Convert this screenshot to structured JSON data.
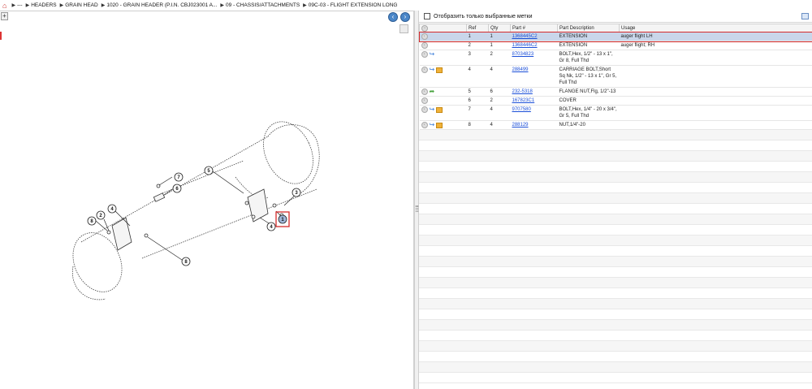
{
  "breadcrumb": {
    "items": [
      "---",
      "HEADERS",
      "GRAIN HEAD",
      "1020 - GRAIN HEADER (P.I.N. CBJ023001 A...",
      "09 - CHASSIS/ATTACHMENTS",
      "09C-03 - FLIGHT EXTENSION LONG"
    ]
  },
  "filter": {
    "label": "Отобразить только выбранные метки",
    "checked": false
  },
  "table": {
    "columns": [
      "Ref",
      "Qty",
      "Part #",
      "Part Description",
      "Usage"
    ],
    "rows": [
      {
        "ref": "1",
        "qty": "1",
        "part": "1368445C2",
        "desc": "EXTENSION",
        "usage": "auger flight LH",
        "icons": [],
        "selected": true
      },
      {
        "ref": "2",
        "qty": "1",
        "part": "1368446C2",
        "desc": "EXTENSION",
        "usage": "auger flight; RH",
        "icons": [],
        "selected": false
      },
      {
        "ref": "3",
        "qty": "2",
        "part": "87034823",
        "desc": "BOLT,Hex, 1/2\" - 13 x 1\", Gr 8, Full Thd",
        "usage": "",
        "icons": [
          "info"
        ],
        "selected": false
      },
      {
        "ref": "4",
        "qty": "4",
        "part": "288499",
        "desc": "CARRIAGE BOLT,Short Sq Nk, 1/2\" - 13 x 1\", Gr 5, Full Thd",
        "usage": "",
        "icons": [
          "info",
          "box"
        ],
        "selected": false
      },
      {
        "ref": "5",
        "qty": "6",
        "part": "232-5318",
        "desc": "FLANGE NUT,Flg, 1/2\"-13",
        "usage": "",
        "icons": [
          "green"
        ],
        "selected": false
      },
      {
        "ref": "6",
        "qty": "2",
        "part": "167823C1",
        "desc": "COVER",
        "usage": "",
        "icons": [],
        "selected": false
      },
      {
        "ref": "7",
        "qty": "4",
        "part": "9707580",
        "desc": "BOLT,Hex, 1/4\" - 20 x 3/4\", Gr 5, Full Thd",
        "usage": "",
        "icons": [
          "info",
          "box"
        ],
        "selected": false
      },
      {
        "ref": "8",
        "qty": "4",
        "part": "288129",
        "desc": "NUT,1/4\"-20",
        "usage": "",
        "icons": [
          "info",
          "box"
        ],
        "selected": false
      }
    ]
  },
  "diagram": {
    "callouts": [
      "1",
      "2",
      "3",
      "4",
      "4",
      "5",
      "6",
      "7",
      "8",
      "8"
    ]
  },
  "colors": {
    "selection": "#c9d6ea",
    "highlight_outline": "#d52b2b",
    "link": "#1b4fd8"
  }
}
